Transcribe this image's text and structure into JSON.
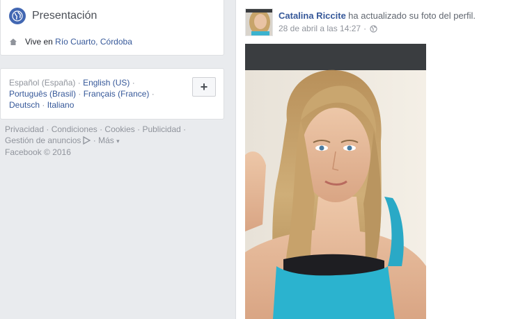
{
  "intro": {
    "title": "Presentación",
    "lives_prefix": "Vive en",
    "lives_location": "Río Cuarto, Córdoba"
  },
  "languages": {
    "current": "Español (España)",
    "items": [
      "English (US)",
      "Português (Brasil)",
      "Français (France)",
      "Deutsch",
      "Italiano"
    ],
    "add_label": "+"
  },
  "footer": {
    "links": [
      "Privacidad",
      "Condiciones",
      "Cookies",
      "Publicidad"
    ],
    "ads_label": "Gestión de anuncios",
    "more_label": "Más",
    "copyright": "Facebook © 2016"
  },
  "post": {
    "author": "Catalina Riccite",
    "action": "ha actualizado su foto del perfil.",
    "timestamp": "28 de abril a las 14:27",
    "separator": "·",
    "privacy_icon": "globe-icon"
  },
  "colors": {
    "brand_blue": "#4267b2",
    "link_blue": "#365899",
    "background": "#e9ebee"
  }
}
